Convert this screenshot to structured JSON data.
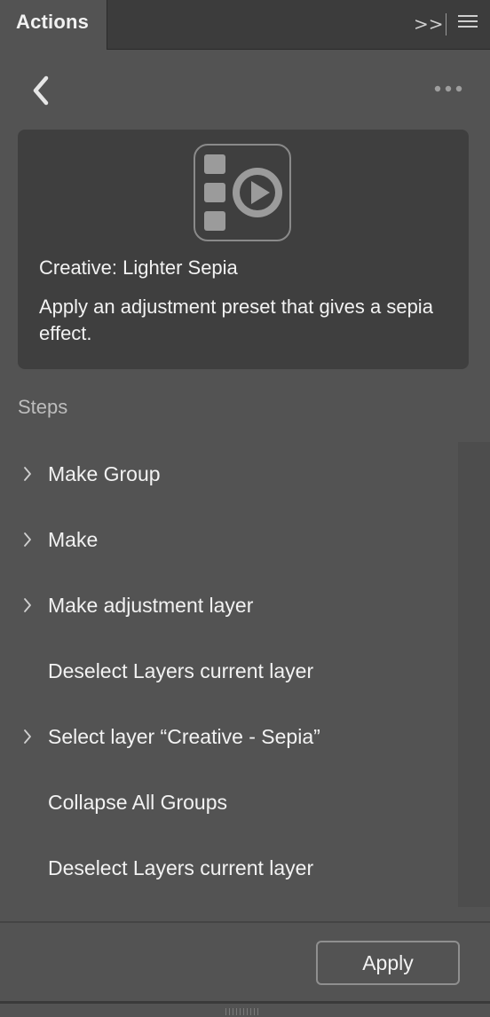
{
  "panel": {
    "tab_label": "Actions",
    "collapse_glyph": ">>"
  },
  "header": {
    "back_icon": "chevron-left-icon",
    "more_icon": "ellipsis-icon"
  },
  "card": {
    "icon": "action-play-icon",
    "title": "Creative: Lighter Sepia",
    "description": "Apply an adjustment preset that gives a sepia effect."
  },
  "steps": {
    "heading": "Steps",
    "items": [
      {
        "label": "Make Group",
        "expandable": true
      },
      {
        "label": "Make",
        "expandable": true
      },
      {
        "label": "Make adjustment layer",
        "expandable": true
      },
      {
        "label": "Deselect Layers current layer",
        "expandable": false
      },
      {
        "label": "Select layer “Creative - Sepia”",
        "expandable": true
      },
      {
        "label": "Collapse All Groups",
        "expandable": false
      },
      {
        "label": "Deselect Layers current layer",
        "expandable": false
      }
    ]
  },
  "footer": {
    "apply_label": "Apply"
  },
  "colors": {
    "panel_bg": "#535353",
    "card_bg": "#3f3f3f",
    "tabbar_bg": "#3c3c3c",
    "text": "#f2f2f2",
    "muted_text": "#bdbdbd"
  }
}
